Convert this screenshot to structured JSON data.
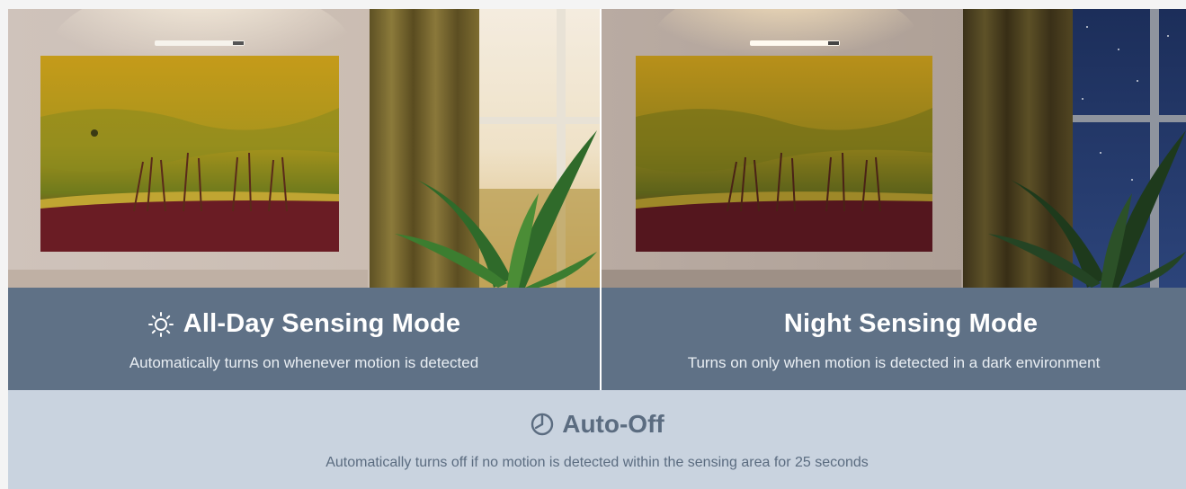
{
  "modes": [
    {
      "title": "All-Day Sensing Mode",
      "description": "Automatically turns on whenever motion is detected",
      "icon": "sun-icon"
    },
    {
      "title": "Night Sensing Mode",
      "description": "Turns on only when motion is detected in a dark environment",
      "icon": "moon-icon"
    }
  ],
  "auto_off": {
    "title": "Auto-Off",
    "description": "Automatically turns off if no motion is detected within the sensing area for 25 seconds",
    "icon": "timer-icon"
  },
  "colors": {
    "caption_bg": "#5f7186",
    "auto_off_bg": "#c9d3df",
    "auto_off_text": "#5b6c80"
  }
}
